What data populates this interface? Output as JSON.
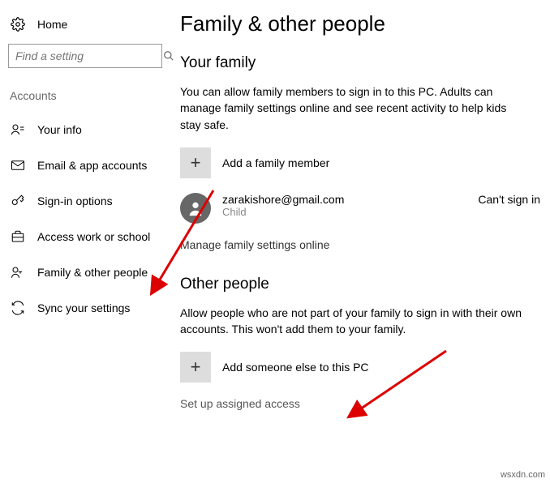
{
  "sidebar": {
    "home_label": "Home",
    "search_placeholder": "Find a setting",
    "section_label": "Accounts",
    "items": [
      {
        "label": "Your info"
      },
      {
        "label": "Email & app accounts"
      },
      {
        "label": "Sign-in options"
      },
      {
        "label": "Access work or school"
      },
      {
        "label": "Family & other people"
      },
      {
        "label": "Sync your settings"
      }
    ]
  },
  "main": {
    "page_title": "Family & other people",
    "family": {
      "title": "Your family",
      "desc": "You can allow family members to sign in to this PC. Adults can manage family settings online and see recent activity to help kids stay safe.",
      "add_label": "Add a family member",
      "user_email": "zarakishore@gmail.com",
      "user_role": "Child",
      "user_status": "Can't sign in",
      "manage_link": "Manage family settings online"
    },
    "other": {
      "title": "Other people",
      "desc": "Allow people who are not part of your family to sign in with their own accounts. This won't add them to your family.",
      "add_label": "Add someone else to this PC",
      "setup_link": "Set up assigned access"
    }
  },
  "watermark": "wsxdn.com"
}
